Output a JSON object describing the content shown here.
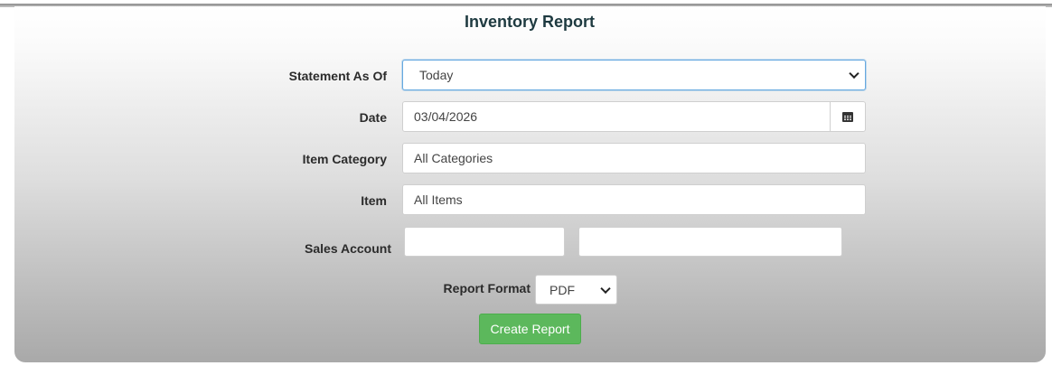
{
  "page": {
    "title": "Inventory Report"
  },
  "form": {
    "statement_as_of": {
      "label": "Statement As Of",
      "selected": "Today"
    },
    "date": {
      "label": "Date",
      "value": "03/04/2026",
      "icon": "calendar-icon"
    },
    "item_category": {
      "label": "Item Category",
      "value": "All Categories"
    },
    "item": {
      "label": "Item",
      "value": "All Items"
    },
    "sales_account": {
      "label": "Sales Account",
      "code_value": "",
      "name_value": ""
    },
    "report_format": {
      "label": "Report Format",
      "selected": "PDF"
    },
    "submit_label": "Create Report"
  },
  "colors": {
    "title": "#1e3a40",
    "button": "#5cb85c",
    "focus_border": "#66a9e0"
  }
}
